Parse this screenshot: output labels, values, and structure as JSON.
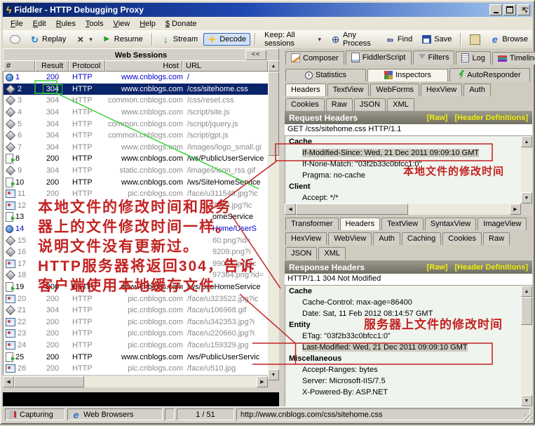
{
  "colors": {
    "navy": "#0a246a",
    "red": "#c32222",
    "green": "#2fd32f"
  },
  "window": {
    "title": "Fiddler - HTTP Debugging Proxy"
  },
  "menu": {
    "items": [
      {
        "label": "File"
      },
      {
        "label": "Edit"
      },
      {
        "label": "Rules"
      },
      {
        "label": "Tools"
      },
      {
        "label": "View"
      },
      {
        "label": "Help"
      },
      {
        "label": "$ Donate"
      }
    ]
  },
  "toolbar": {
    "buttons": [
      {
        "icon": "comment",
        "label": ""
      },
      {
        "icon": "replay",
        "label": "Replay"
      },
      {
        "icon": "delete",
        "label": "",
        "dropdown": true
      },
      {
        "icon": "resume",
        "label": "Resume"
      },
      {
        "sep": true
      },
      {
        "icon": "stream",
        "label": "Stream"
      },
      {
        "icon": "decode",
        "label": "Decode",
        "pressed": true
      },
      {
        "sep": true
      },
      {
        "label": "Keep: All sessions",
        "dropdown": true
      },
      {
        "icon": "any-process",
        "label": "Any Process"
      },
      {
        "icon": "find",
        "label": "Find"
      },
      {
        "icon": "save",
        "label": "Save"
      },
      {
        "sep": true
      },
      {
        "icon": "clipboard",
        "label": ""
      },
      {
        "icon": "browse",
        "label": "Browse"
      }
    ]
  },
  "sessions": {
    "panel_title": "Web Sessions",
    "collapse_button": "<<",
    "columns": [
      "#",
      "Result",
      "Protocol",
      "Host",
      "URL"
    ],
    "rows": [
      {
        "n": "1",
        "icon": "globe",
        "result": "200",
        "protocol": "HTTP",
        "host": "www.cnblogs.com",
        "url": "/",
        "style": "blue"
      },
      {
        "n": "2",
        "icon": "css",
        "result": "304",
        "protocol": "HTTP",
        "host": "www.cnblogs.com",
        "url": "/css/sitehome.css",
        "style": "selected",
        "result_boxed": true
      },
      {
        "n": "3",
        "icon": "css",
        "result": "304",
        "protocol": "HTTP",
        "host": "common.cnblogs.com",
        "url": "/css/reset.css",
        "style": "gray"
      },
      {
        "n": "4",
        "icon": "css",
        "result": "304",
        "protocol": "HTTP",
        "host": "www.cnblogs.com",
        "url": "/script/site.js",
        "style": "gray"
      },
      {
        "n": "5",
        "icon": "css",
        "result": "304",
        "protocol": "HTTP",
        "host": "common.cnblogs.com",
        "url": "/script/jquery.js",
        "style": "gray"
      },
      {
        "n": "6",
        "icon": "css",
        "result": "304",
        "protocol": "HTTP",
        "host": "common.cnblogs.com",
        "url": "/script/gpt.js",
        "style": "gray"
      },
      {
        "n": "7",
        "icon": "css",
        "result": "304",
        "protocol": "HTTP",
        "host": "www.cnblogs.com",
        "url": "/images/logo_small.gi",
        "style": "gray"
      },
      {
        "n": "8",
        "icon": "ws",
        "result": "200",
        "protocol": "HTTP",
        "host": "www.cnblogs.com",
        "url": "/ws/PublicUserService",
        "style": "black"
      },
      {
        "n": "9",
        "icon": "css",
        "result": "304",
        "protocol": "HTTP",
        "host": "static.cnblogs.com",
        "url": "/images/icon_rss.gif",
        "style": "gray"
      },
      {
        "n": "10",
        "icon": "ws",
        "result": "200",
        "protocol": "HTTP",
        "host": "www.cnblogs.com",
        "url": "/ws/SiteHomeService",
        "style": "black"
      },
      {
        "n": "11",
        "icon": "img",
        "result": "200",
        "protocol": "HTTP",
        "host": "pic.cnblogs.com",
        "url": "/face/u311549.jpg?ic",
        "style": "gray"
      },
      {
        "n": "12",
        "icon": "img",
        "result": "",
        "protocol": "",
        "host": "",
        "url": "3417.jpg?ic",
        "style": "gray",
        "frag": true
      },
      {
        "n": "13",
        "icon": "ws",
        "result": "",
        "protocol": "",
        "host": "",
        "url": "omeService",
        "style": "black",
        "frag": true
      },
      {
        "n": "14",
        "icon": "globe",
        "result": "",
        "protocol": "",
        "host": "",
        "url": "Home/UserS",
        "style": "blue",
        "frag": true
      },
      {
        "n": "15",
        "icon": "css",
        "result": "",
        "protocol": "",
        "host": "",
        "url": "60.png?id=",
        "style": "gray",
        "frag": true
      },
      {
        "n": "16",
        "icon": "css",
        "result": "",
        "protocol": "",
        "host": "",
        "url": "9209.png?i",
        "style": "gray",
        "frag": true
      },
      {
        "n": "17",
        "icon": "img",
        "result": "",
        "protocol": "",
        "host": "",
        "url": "99034.jpg?ic",
        "style": "gray",
        "frag": true
      },
      {
        "n": "18",
        "icon": "css",
        "result": "",
        "protocol": "",
        "host": "",
        "url": "97364.png?id=",
        "style": "gray",
        "frag": true
      },
      {
        "n": "19",
        "icon": "ws",
        "result": "200",
        "protocol": "HTTP",
        "host": "www.cnblogs.com",
        "url": "/ws/SiteHomeService",
        "style": "black"
      },
      {
        "n": "20",
        "icon": "img",
        "result": "200",
        "protocol": "HTTP",
        "host": "pic.cnblogs.com",
        "url": "/face/u323522.jpg?ic",
        "style": "gray"
      },
      {
        "n": "21",
        "icon": "css",
        "result": "304",
        "protocol": "HTTP",
        "host": "pic.cnblogs.com",
        "url": "/face/u106968.gif",
        "style": "gray"
      },
      {
        "n": "22",
        "icon": "img",
        "result": "200",
        "protocol": "HTTP",
        "host": "pic.cnblogs.com",
        "url": "/face/u342353.jpg?i",
        "style": "gray"
      },
      {
        "n": "23",
        "icon": "img",
        "result": "200",
        "protocol": "HTTP",
        "host": "pic.cnblogs.com",
        "url": "/face/u220660.jpg?i",
        "style": "gray"
      },
      {
        "n": "24",
        "icon": "img",
        "result": "200",
        "protocol": "HTTP",
        "host": "pic.cnblogs.com",
        "url": "/face/u159329.jpg",
        "style": "gray"
      },
      {
        "n": "25",
        "icon": "ws",
        "result": "200",
        "protocol": "HTTP",
        "host": "www.cnblogs.com",
        "url": "/ws/PublicUserServic",
        "style": "black"
      },
      {
        "n": "26",
        "icon": "img",
        "result": "200",
        "protocol": "HTTP",
        "host": "pic.cnblogs.com",
        "url": "/face/u510.jpg",
        "style": "gray"
      }
    ]
  },
  "right": {
    "main_tabs": [
      {
        "label": "Composer",
        "icon": "composer"
      },
      {
        "label": "FiddlerScript",
        "icon": "fiddlerscript"
      },
      {
        "label": "Filters",
        "icon": "filters"
      },
      {
        "label": "Log",
        "icon": "log"
      },
      {
        "label": "Timeline",
        "icon": "timeline"
      }
    ],
    "view_tabs": [
      {
        "label": "Statistics",
        "icon": "statistics"
      },
      {
        "label": "Inspectors",
        "icon": "inspectors",
        "active": true
      },
      {
        "label": "AutoResponder",
        "icon": "autoresponder"
      }
    ],
    "request": {
      "tabs_row1": [
        {
          "label": "Headers",
          "active": true
        },
        {
          "label": "TextView"
        },
        {
          "label": "WebForms"
        },
        {
          "label": "HexView"
        },
        {
          "label": "Auth"
        }
      ],
      "tabs_row2": [
        {
          "label": "Cookies"
        },
        {
          "label": "Raw"
        },
        {
          "label": "JSON"
        },
        {
          "label": "XML"
        }
      ],
      "title": "Request Headers",
      "links": [
        "[Raw]",
        "[Header Definitions]"
      ],
      "request_line": "GET /css/sitehome.css HTTP/1.1",
      "groups": [
        {
          "name": "Cache",
          "items": [
            {
              "text": "If-Modified-Since: Wed, 21 Dec 2011 09:09:10 GMT",
              "highlight": true
            },
            {
              "text": "If-None-Match: \"03f2b33c0bfcc1:0\""
            },
            {
              "text": "Pragma: no-cache"
            }
          ]
        },
        {
          "name": "Client",
          "items": [
            {
              "text": "Accept: */*"
            }
          ]
        }
      ]
    },
    "response": {
      "tabs_row1": [
        {
          "label": "Transformer"
        },
        {
          "label": "Headers",
          "active": true
        },
        {
          "label": "TextView"
        },
        {
          "label": "SyntaxView"
        },
        {
          "label": "ImageView"
        }
      ],
      "tabs_row2": [
        {
          "label": "HexView"
        },
        {
          "label": "WebView"
        },
        {
          "label": "Auth"
        },
        {
          "label": "Caching"
        },
        {
          "label": "Cookies"
        },
        {
          "label": "Raw"
        }
      ],
      "tabs_row3": [
        {
          "label": "JSON"
        },
        {
          "label": "XML"
        }
      ],
      "title": "Response Headers",
      "links": [
        "[Raw]",
        "[Header Definitions]"
      ],
      "status_line": "HTTP/1.1 304 Not Modified",
      "groups": [
        {
          "name": "Cache",
          "items": [
            {
              "text": "Cache-Control: max-age=86400"
            },
            {
              "text": "Date: Sat, 11 Feb 2012 08:14:57 GMT"
            }
          ]
        },
        {
          "name": "Entity",
          "items": [
            {
              "text": "ETag: \"03f2b33c0bfcc1:0\""
            },
            {
              "text": "Last-Modified: Wed, 21 Dec 2011 09:09:10 GMT",
              "highlight": true
            }
          ]
        },
        {
          "name": "Miscellaneous",
          "items": [
            {
              "text": "Accept-Ranges: bytes"
            },
            {
              "text": "Server: Microsoft-IIS/7.5"
            },
            {
              "text": "X-Powered-By: ASP.NET"
            }
          ]
        }
      ]
    }
  },
  "statusbar": {
    "capturing": "Capturing",
    "filter": "Web Browsers",
    "count": "1 / 51",
    "url": "http://www.cnblogs.com/css/sitehome.css"
  },
  "annotations": {
    "left_lines": [
      "本地文件的修改时间和服务",
      "器上的文件修改时间一样。",
      "说明文件没有更新过。",
      "HTTP服务器将返回304，告诉",
      "客户端使用本地缓存文件"
    ],
    "request_note": "本地文件的修改时间",
    "response_note": "服务器上文件的修改时间"
  }
}
